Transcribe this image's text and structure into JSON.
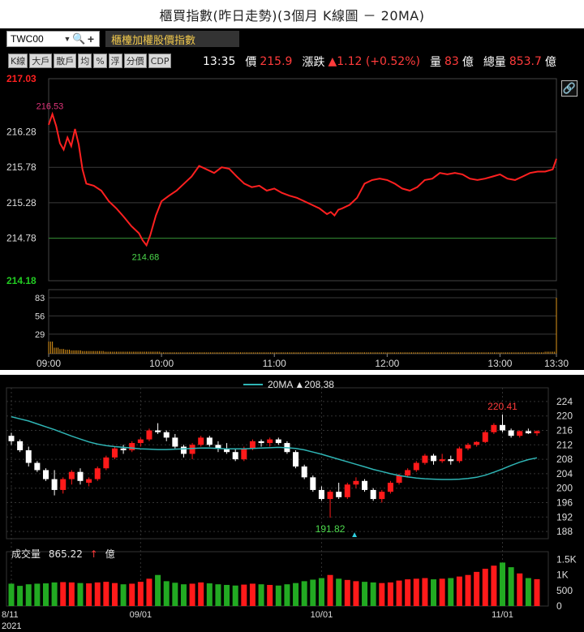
{
  "title": "櫃買指數(昨日走勢)(3個月 K線圖 － 20MA)",
  "toolbar": {
    "symbol": "TWC00",
    "caret": "▼",
    "search_icon": "🔍",
    "add_label": "+",
    "index_name": "櫃檯加權股價指數",
    "tabs": [
      "K線",
      "大戶",
      "散戶",
      "均",
      "%",
      "浮",
      "分價",
      "CDP"
    ],
    "time": "13:35",
    "price_label": "價",
    "price": "215.9",
    "change_label": "漲跌",
    "change": "▲1.12 (+0.52%)",
    "volume_label": "量",
    "volume": "83",
    "volume_unit": "億",
    "total_label": "總量",
    "total": "853.7",
    "total_unit": "億",
    "link_icon": "🔗"
  },
  "intraday_chart": {
    "type": "line",
    "y_ticks": [
      "217.03",
      "216.28",
      "215.78",
      "215.28",
      "214.78",
      "214.18"
    ],
    "y_tick_values": [
      217.03,
      216.28,
      215.78,
      215.28,
      214.78,
      214.18
    ],
    "ylim": [
      214.18,
      217.03
    ],
    "ref_value": 214.78,
    "high_label": "216.53",
    "low_label": "214.68",
    "volume_ticks": [
      "83",
      "56",
      "29"
    ],
    "volume_tick_values": [
      83,
      56,
      29
    ],
    "x_ticks": [
      "09:00",
      "10:00",
      "11:00",
      "12:00",
      "13:00",
      "13:30"
    ],
    "x_tick_minutes": [
      0,
      60,
      120,
      180,
      240,
      270
    ],
    "colors": {
      "line": "#ff2020",
      "volume": "#e0961a",
      "top_axis": "#ff2020",
      "bottom_axis": "#22cc22",
      "grid": "#3a3a3a"
    },
    "series": [
      {
        "t": 0,
        "v": 216.38
      },
      {
        "t": 2,
        "v": 216.53
      },
      {
        "t": 4,
        "v": 216.36
      },
      {
        "t": 6,
        "v": 216.12
      },
      {
        "t": 8,
        "v": 216.03
      },
      {
        "t": 10,
        "v": 216.2
      },
      {
        "t": 12,
        "v": 216.08
      },
      {
        "t": 14,
        "v": 216.32
      },
      {
        "t": 16,
        "v": 216.1
      },
      {
        "t": 18,
        "v": 215.75
      },
      {
        "t": 20,
        "v": 215.55
      },
      {
        "t": 24,
        "v": 215.52
      },
      {
        "t": 28,
        "v": 215.45
      },
      {
        "t": 32,
        "v": 215.3
      },
      {
        "t": 36,
        "v": 215.2
      },
      {
        "t": 40,
        "v": 215.08
      },
      {
        "t": 44,
        "v": 214.95
      },
      {
        "t": 48,
        "v": 214.85
      },
      {
        "t": 50,
        "v": 214.75
      },
      {
        "t": 52,
        "v": 214.68
      },
      {
        "t": 54,
        "v": 214.82
      },
      {
        "t": 57,
        "v": 215.1
      },
      {
        "t": 60,
        "v": 215.3
      },
      {
        "t": 64,
        "v": 215.38
      },
      {
        "t": 68,
        "v": 215.45
      },
      {
        "t": 72,
        "v": 215.55
      },
      {
        "t": 76,
        "v": 215.65
      },
      {
        "t": 80,
        "v": 215.8
      },
      {
        "t": 84,
        "v": 215.75
      },
      {
        "t": 88,
        "v": 215.7
      },
      {
        "t": 92,
        "v": 215.78
      },
      {
        "t": 96,
        "v": 215.76
      },
      {
        "t": 100,
        "v": 215.65
      },
      {
        "t": 104,
        "v": 215.55
      },
      {
        "t": 108,
        "v": 215.5
      },
      {
        "t": 112,
        "v": 215.52
      },
      {
        "t": 116,
        "v": 215.45
      },
      {
        "t": 120,
        "v": 215.48
      },
      {
        "t": 124,
        "v": 215.42
      },
      {
        "t": 128,
        "v": 215.38
      },
      {
        "t": 132,
        "v": 215.35
      },
      {
        "t": 136,
        "v": 215.3
      },
      {
        "t": 140,
        "v": 215.25
      },
      {
        "t": 144,
        "v": 215.2
      },
      {
        "t": 148,
        "v": 215.12
      },
      {
        "t": 150,
        "v": 215.15
      },
      {
        "t": 152,
        "v": 215.1
      },
      {
        "t": 154,
        "v": 215.18
      },
      {
        "t": 156,
        "v": 215.2
      },
      {
        "t": 160,
        "v": 215.25
      },
      {
        "t": 164,
        "v": 215.35
      },
      {
        "t": 168,
        "v": 215.55
      },
      {
        "t": 172,
        "v": 215.6
      },
      {
        "t": 176,
        "v": 215.62
      },
      {
        "t": 180,
        "v": 215.6
      },
      {
        "t": 184,
        "v": 215.55
      },
      {
        "t": 188,
        "v": 215.48
      },
      {
        "t": 192,
        "v": 215.45
      },
      {
        "t": 196,
        "v": 215.5
      },
      {
        "t": 200,
        "v": 215.6
      },
      {
        "t": 204,
        "v": 215.62
      },
      {
        "t": 208,
        "v": 215.7
      },
      {
        "t": 212,
        "v": 215.68
      },
      {
        "t": 216,
        "v": 215.7
      },
      {
        "t": 220,
        "v": 215.68
      },
      {
        "t": 224,
        "v": 215.62
      },
      {
        "t": 228,
        "v": 215.6
      },
      {
        "t": 232,
        "v": 215.62
      },
      {
        "t": 236,
        "v": 215.65
      },
      {
        "t": 240,
        "v": 215.68
      },
      {
        "t": 244,
        "v": 215.62
      },
      {
        "t": 248,
        "v": 215.6
      },
      {
        "t": 252,
        "v": 215.65
      },
      {
        "t": 256,
        "v": 215.7
      },
      {
        "t": 260,
        "v": 215.72
      },
      {
        "t": 264,
        "v": 215.72
      },
      {
        "t": 268,
        "v": 215.75
      },
      {
        "t": 270,
        "v": 215.9
      }
    ],
    "volume_series": [
      {
        "t": 0,
        "v": 18
      },
      {
        "t": 3,
        "v": 9
      },
      {
        "t": 6,
        "v": 7
      },
      {
        "t": 9,
        "v": 6
      },
      {
        "t": 12,
        "v": 5
      },
      {
        "t": 15,
        "v": 5
      },
      {
        "t": 18,
        "v": 4
      },
      {
        "t": 21,
        "v": 4
      },
      {
        "t": 24,
        "v": 4
      },
      {
        "t": 27,
        "v": 4
      },
      {
        "t": 30,
        "v": 3
      },
      {
        "t": 33,
        "v": 3
      },
      {
        "t": 36,
        "v": 3
      },
      {
        "t": 39,
        "v": 3
      },
      {
        "t": 42,
        "v": 3
      },
      {
        "t": 45,
        "v": 3
      },
      {
        "t": 48,
        "v": 3
      },
      {
        "t": 51,
        "v": 3
      },
      {
        "t": 54,
        "v": 3
      },
      {
        "t": 57,
        "v": 3
      },
      {
        "t": 60,
        "v": 2
      },
      {
        "t": 66,
        "v": 2
      },
      {
        "t": 72,
        "v": 2
      },
      {
        "t": 78,
        "v": 2
      },
      {
        "t": 84,
        "v": 2
      },
      {
        "t": 90,
        "v": 2
      },
      {
        "t": 96,
        "v": 2
      },
      {
        "t": 102,
        "v": 2
      },
      {
        "t": 108,
        "v": 2
      },
      {
        "t": 114,
        "v": 2
      },
      {
        "t": 120,
        "v": 2
      },
      {
        "t": 126,
        "v": 2
      },
      {
        "t": 132,
        "v": 2
      },
      {
        "t": 138,
        "v": 2
      },
      {
        "t": 144,
        "v": 2
      },
      {
        "t": 150,
        "v": 2
      },
      {
        "t": 156,
        "v": 2
      },
      {
        "t": 162,
        "v": 2
      },
      {
        "t": 168,
        "v": 2
      },
      {
        "t": 174,
        "v": 2
      },
      {
        "t": 180,
        "v": 2
      },
      {
        "t": 186,
        "v": 2
      },
      {
        "t": 192,
        "v": 2
      },
      {
        "t": 198,
        "v": 2
      },
      {
        "t": 204,
        "v": 2
      },
      {
        "t": 210,
        "v": 2
      },
      {
        "t": 216,
        "v": 2
      },
      {
        "t": 222,
        "v": 2
      },
      {
        "t": 228,
        "v": 2
      },
      {
        "t": 234,
        "v": 2
      },
      {
        "t": 240,
        "v": 2
      },
      {
        "t": 246,
        "v": 2
      },
      {
        "t": 252,
        "v": 2
      },
      {
        "t": 258,
        "v": 2
      },
      {
        "t": 264,
        "v": 3
      },
      {
        "t": 270,
        "v": 83
      }
    ]
  },
  "kline_chart": {
    "type": "candlestick",
    "legend": {
      "name": "20MA",
      "value": "▲208.38"
    },
    "y_ticks": [
      "224",
      "220",
      "216",
      "212",
      "208",
      "204",
      "200",
      "196",
      "192",
      "188"
    ],
    "y_tick_values": [
      224,
      220,
      216,
      212,
      208,
      204,
      200,
      196,
      192,
      188
    ],
    "ylim": [
      186,
      226
    ],
    "high_label": "220.41",
    "low_label": "191.82",
    "low_marker": "▲",
    "volume_label": "成交量",
    "volume_value": "865.22",
    "volume_arrow": "↑",
    "volume_unit": "億",
    "volume_ticks": [
      "1.5K",
      "1K",
      "500",
      "0"
    ],
    "volume_tick_values": [
      1500,
      1000,
      500,
      0
    ],
    "vlim": [
      0,
      1750
    ],
    "x_ticks": [
      "8/11",
      "09/01",
      "10/01",
      "11/01"
    ],
    "x_tick_index": [
      0,
      15,
      36,
      57
    ],
    "year": "2021",
    "colors": {
      "up": "#ff1a1a",
      "down": "#ffffff",
      "ma": "#2fb5b5",
      "vol_up": "#ff1a1a",
      "vol_down": "#22aa22",
      "grid": "#333333"
    },
    "ohlc": [
      [
        214.5,
        215.3,
        212.0,
        213.0
      ],
      [
        213.0,
        213.5,
        210.0,
        210.5
      ],
      [
        210.5,
        211.5,
        206.0,
        207.0
      ],
      [
        207.0,
        207.5,
        204.5,
        205.0
      ],
      [
        205.0,
        205.5,
        202.0,
        202.5
      ],
      [
        202.5,
        205.0,
        198.0,
        199.5
      ],
      [
        199.5,
        203.0,
        198.5,
        202.5
      ],
      [
        202.5,
        205.0,
        201.0,
        204.5
      ],
      [
        204.5,
        205.5,
        201.0,
        202.0
      ],
      [
        201.5,
        203.0,
        200.5,
        202.5
      ],
      [
        202.5,
        206.0,
        202.0,
        205.5
      ],
      [
        205.5,
        209.0,
        205.0,
        208.5
      ],
      [
        208.5,
        211.5,
        208.0,
        211.0
      ],
      [
        211.0,
        212.0,
        209.5,
        210.5
      ],
      [
        210.5,
        213.0,
        210.0,
        212.5
      ],
      [
        212.5,
        214.0,
        211.5,
        213.5
      ],
      [
        213.5,
        216.5,
        213.0,
        216.0
      ],
      [
        216.0,
        218.0,
        215.0,
        215.5
      ],
      [
        215.5,
        216.0,
        213.0,
        214.0
      ],
      [
        214.0,
        215.0,
        211.0,
        211.5
      ],
      [
        211.5,
        212.0,
        208.5,
        209.5
      ],
      [
        209.5,
        212.5,
        208.0,
        212.0
      ],
      [
        212.0,
        214.5,
        211.5,
        214.0
      ],
      [
        214.0,
        214.5,
        211.5,
        212.0
      ],
      [
        212.0,
        213.0,
        210.0,
        211.0
      ],
      [
        211.0,
        212.5,
        209.5,
        210.0
      ],
      [
        210.0,
        211.0,
        207.5,
        208.0
      ],
      [
        208.0,
        211.5,
        207.5,
        211.0
      ],
      [
        211.0,
        213.5,
        210.5,
        213.0
      ],
      [
        213.0,
        213.5,
        211.5,
        212.5
      ],
      [
        212.5,
        214.0,
        211.5,
        213.5
      ],
      [
        213.5,
        214.0,
        212.0,
        212.5
      ],
      [
        212.5,
        213.0,
        209.5,
        210.0
      ],
      [
        210.0,
        210.5,
        205.5,
        206.0
      ],
      [
        206.0,
        206.5,
        202.5,
        203.0
      ],
      [
        203.0,
        203.5,
        199.0,
        199.5
      ],
      [
        199.5,
        200.5,
        196.5,
        197.0
      ],
      [
        197.0,
        199.5,
        191.8,
        199.0
      ],
      [
        199.0,
        201.5,
        197.0,
        197.5
      ],
      [
        197.5,
        201.5,
        197.0,
        201.0
      ],
      [
        201.0,
        203.0,
        200.0,
        202.0
      ],
      [
        202.0,
        202.5,
        199.0,
        199.5
      ],
      [
        199.5,
        200.0,
        196.5,
        197.0
      ],
      [
        197.0,
        199.5,
        196.0,
        199.0
      ],
      [
        199.0,
        202.0,
        198.5,
        201.5
      ],
      [
        201.5,
        204.0,
        201.0,
        203.5
      ],
      [
        203.5,
        205.5,
        203.0,
        205.0
      ],
      [
        205.0,
        207.5,
        204.5,
        207.0
      ],
      [
        207.0,
        209.5,
        206.5,
        209.0
      ],
      [
        209.0,
        209.5,
        206.5,
        207.5
      ],
      [
        207.5,
        209.5,
        207.0,
        208.0
      ],
      [
        208.0,
        209.0,
        206.5,
        207.5
      ],
      [
        207.5,
        211.5,
        207.0,
        211.0
      ],
      [
        211.0,
        212.5,
        210.5,
        212.0
      ],
      [
        212.0,
        213.0,
        211.5,
        212.8
      ],
      [
        212.8,
        216.0,
        212.5,
        215.5
      ],
      [
        215.5,
        218.0,
        215.0,
        217.5
      ],
      [
        217.5,
        220.4,
        215.5,
        216.0
      ],
      [
        216.0,
        216.5,
        214.0,
        214.5
      ],
      [
        214.5,
        216.0,
        214.0,
        215.8
      ],
      [
        215.8,
        216.5,
        215.0,
        215.2
      ],
      [
        215.2,
        216.0,
        214.5,
        215.8
      ]
    ],
    "ma20": [
      219.8,
      219.2,
      218.6,
      217.8,
      217.0,
      216.2,
      215.3,
      214.4,
      213.6,
      212.8,
      212.2,
      211.8,
      211.5,
      211.3,
      211.1,
      210.9,
      210.8,
      210.7,
      210.7,
      210.8,
      210.9,
      211.0,
      211.1,
      211.1,
      211.0,
      210.9,
      210.9,
      210.9,
      211.0,
      211.1,
      211.2,
      211.3,
      211.2,
      211.0,
      210.6,
      210.0,
      209.4,
      208.7,
      208.0,
      207.3,
      206.6,
      205.9,
      205.2,
      204.6,
      204.0,
      203.5,
      203.1,
      202.8,
      202.6,
      202.5,
      202.4,
      202.4,
      202.5,
      202.7,
      203.0,
      203.6,
      204.4,
      205.3,
      206.3,
      207.2,
      207.9,
      208.4
    ],
    "volume": [
      720,
      650,
      700,
      720,
      730,
      760,
      770,
      760,
      740,
      730,
      760,
      780,
      740,
      700,
      720,
      780,
      880,
      1000,
      800,
      750,
      700,
      720,
      760,
      730,
      700,
      680,
      660,
      690,
      720,
      700,
      680,
      660,
      700,
      740,
      800,
      850,
      900,
      1000,
      880,
      840,
      800,
      780,
      760,
      740,
      760,
      820,
      860,
      880,
      900,
      860,
      880,
      900,
      950,
      1000,
      1100,
      1200,
      1300,
      1400,
      1250,
      1050,
      900,
      865
    ]
  }
}
